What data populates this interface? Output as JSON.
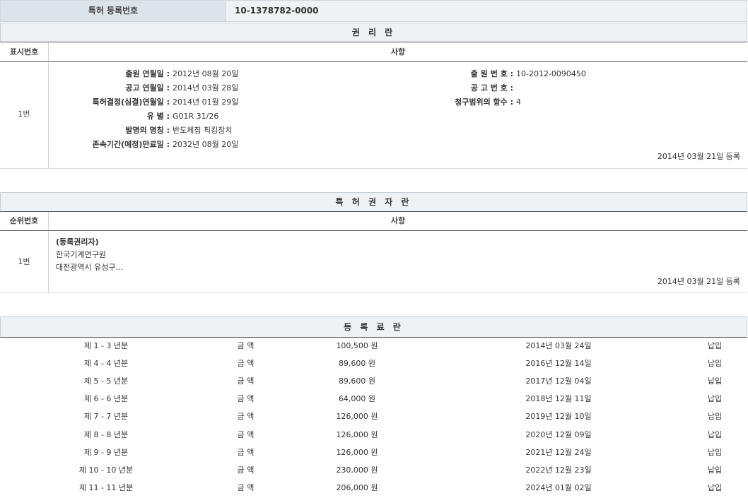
{
  "registration": {
    "label": "특허 등록번호",
    "value": "10-1378782-0000"
  },
  "rights_section": {
    "title": "권 리 란",
    "col_left": "표시번호",
    "col_right": "사항",
    "row_number": "1번",
    "fields_left": [
      {
        "key": "출원 연월일 :",
        "value": "2012년 08월 20일"
      },
      {
        "key": "공고 연월일 :",
        "value": "2014년 03월 28일"
      },
      {
        "key": "특허결정(심결)연월일 :",
        "value": "2014년 01월 29일"
      },
      {
        "key": "유    별 :",
        "value": "G01R 31/26"
      },
      {
        "key": "발명의 명칭 :",
        "value": "반도체칩 픽킹장치"
      },
      {
        "key": "존속기간(예정)만료일 :",
        "value": "2032년 08월 20일"
      }
    ],
    "fields_right": [
      {
        "key": "출 원 번 호 :",
        "value": "10-2012-0090450"
      },
      {
        "key": "공 고 번 호 :",
        "value": ""
      },
      {
        "key": "청구범위의 항수 :",
        "value": "4"
      }
    ],
    "registered": "2014년 03월 21일 등록"
  },
  "owner_section": {
    "title": "특 허 권 자 란",
    "col_left": "순위번호",
    "col_right": "사항",
    "row_number": "1번",
    "lines": [
      "(등록권리자)",
      "한국기계연구원",
      "대전광역시 유성구..."
    ],
    "registered": "2014년 03월 21일 등록"
  },
  "fee_section": {
    "title": "등 록 료 란",
    "rows": [
      {
        "period": "제 1 - 3 년분",
        "label": "금 액",
        "amount": "100,500 원",
        "date": "2014년 03월 24일",
        "status": "납입"
      },
      {
        "period": "제 4 - 4 년분",
        "label": "금 액",
        "amount": "89,600 원",
        "date": "2016년 12월 14일",
        "status": "납입"
      },
      {
        "period": "제 5 - 5 년분",
        "label": "금 액",
        "amount": "89,600 원",
        "date": "2017년 12월 04일",
        "status": "납입"
      },
      {
        "period": "제 6 - 6 년분",
        "label": "금 액",
        "amount": "64,000 원",
        "date": "2018년 12월 11일",
        "status": "납입"
      },
      {
        "period": "제 7 - 7 년분",
        "label": "금 액",
        "amount": "126,000 원",
        "date": "2019년 12월 10일",
        "status": "납입"
      },
      {
        "period": "제 8 - 8 년분",
        "label": "금 액",
        "amount": "126,000 원",
        "date": "2020년 12월 09일",
        "status": "납입"
      },
      {
        "period": "제 9 - 9 년분",
        "label": "금 액",
        "amount": "126,000 원",
        "date": "2021년 12월 24일",
        "status": "납입"
      },
      {
        "period": "제 10 - 10 년분",
        "label": "금 액",
        "amount": "230,000 원",
        "date": "2022년 12월 23일",
        "status": "납입"
      },
      {
        "period": "제 11 - 11 년분",
        "label": "금 액",
        "amount": "206,000 원",
        "date": "2024년 01월 02일",
        "status": "납입"
      }
    ]
  }
}
